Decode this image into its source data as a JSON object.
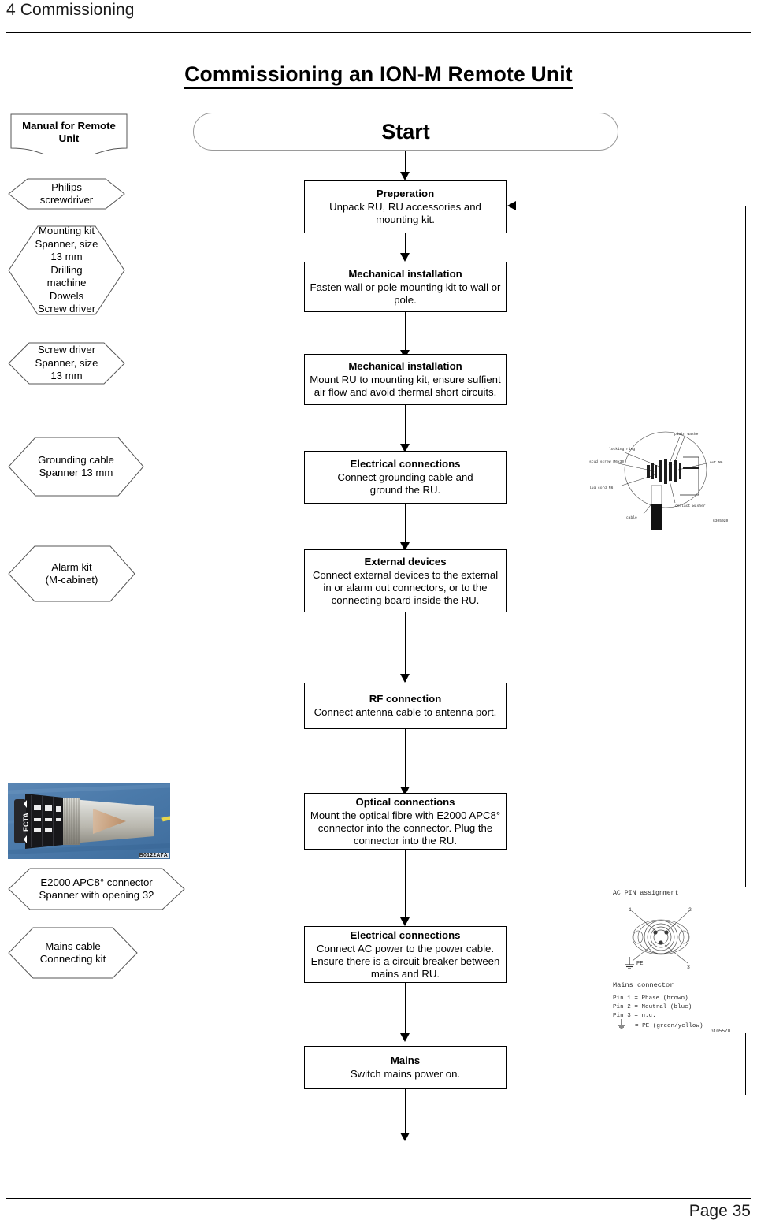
{
  "header": {
    "chapter": "4 Commissioning",
    "title": "Commissioning an ION-M Remote Unit"
  },
  "footer": {
    "page": "Page 35"
  },
  "flow": {
    "start": {
      "label": "Start"
    },
    "steps": [
      {
        "title": "Preperation",
        "body": "Unpack RU, RU accessories and\nmounting kit."
      },
      {
        "title": "Mechanical installation",
        "body": "Fasten wall or pole mounting kit to wall or\npole."
      },
      {
        "title": "Mechanical installation",
        "body": "Mount RU to mounting kit, ensure suffient\nair flow and avoid thermal short circuits."
      },
      {
        "title": "Electrical connections",
        "body": "Connect grounding cable and\nground the RU."
      },
      {
        "title": "External devices",
        "body": "Connect external devices to the external\nin or alarm out connectors, or to the\nconnecting board inside the RU."
      },
      {
        "title": "RF connection",
        "body": "Connect antenna cable to antenna port."
      },
      {
        "title": "Optical connections",
        "body": "Mount the optical fibre with E2000 APC8°\nconnector into the connector. Plug the\nconnector into the RU."
      },
      {
        "title": "Electrical connections",
        "body": "Connect AC power to the power cable.\nEnsure there is a circuit breaker between\nmains and RU."
      },
      {
        "title": "Mains",
        "body": "Switch mains power on."
      }
    ]
  },
  "sidebar": {
    "document": {
      "label": "Manual  for Remote\nUnit"
    },
    "preparations": [
      {
        "label": "Philips\nscrewdriver"
      },
      {
        "label": "Mounting kit\nSpanner, size\n13 mm\nDrilling\nmachine\nDowels\nScrew driver"
      },
      {
        "label": "Screw driver\nSpanner, size\n13 mm"
      },
      {
        "label": "Grounding cable\nSpanner 13 mm"
      },
      {
        "label": "Alarm kit\n(M-cabinet)"
      },
      {
        "label": "E2000 APC8° connector\nSpanner with opening 32"
      },
      {
        "label": "Mains cable\nConnecting kit"
      }
    ],
    "photo": {
      "caption": "B0122A7A",
      "connector_text": "ECTA"
    }
  },
  "figures": {
    "grounding": {
      "caption": "G3050Z0",
      "labels": [
        "plain washer",
        "locking ring",
        "nut M6",
        "lug cord M6",
        "stud screw M6x30",
        "cable",
        "contact washer"
      ]
    },
    "ac_pin": {
      "title": "AC PIN assignment",
      "pin_labels": [
        "1",
        "2",
        "3"
      ],
      "pe_symbol_label": "PE",
      "heading": "Mains connector",
      "lines": [
        "Pin 1 = Phase (brown)",
        "Pin 2 = Neutral (blue)",
        "Pin 3 = n.c.",
        "= PE (green/yellow)"
      ],
      "caption": "G1055Z0"
    }
  },
  "colors": {
    "line": "#000000",
    "terminal_border": "#9a9a9a",
    "hex_border": "#555555",
    "photo_background": "#4f7fae"
  }
}
